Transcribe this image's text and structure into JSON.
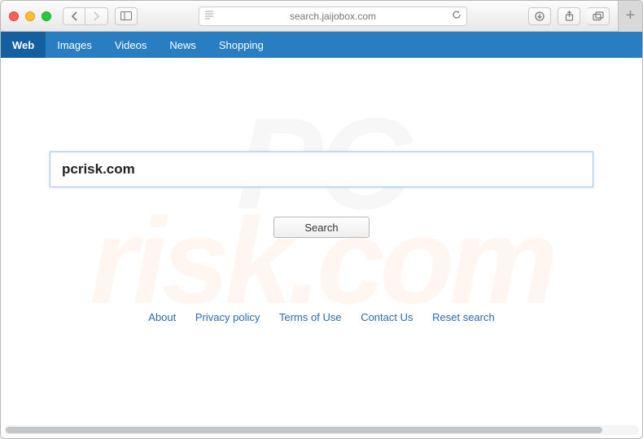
{
  "browser": {
    "url": "search.jaijobox.com"
  },
  "nav": {
    "items": [
      {
        "label": "Web",
        "active": true
      },
      {
        "label": "Images",
        "active": false
      },
      {
        "label": "Videos",
        "active": false
      },
      {
        "label": "News",
        "active": false
      },
      {
        "label": "Shopping",
        "active": false
      }
    ]
  },
  "search": {
    "value": "pcrisk.com",
    "button_label": "Search"
  },
  "footer": {
    "links": [
      "About",
      "Privacy policy",
      "Terms of Use",
      "Contact Us",
      "Reset search"
    ]
  },
  "watermark": {
    "line1": "PC",
    "line2": "risk.com"
  }
}
